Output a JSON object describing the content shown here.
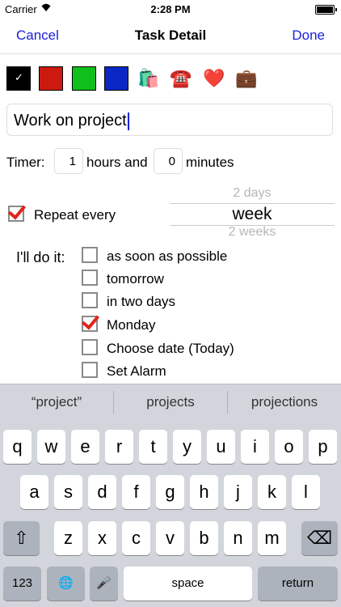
{
  "status": {
    "carrier": "Carrier",
    "time": "2:28 PM"
  },
  "nav": {
    "cancel": "Cancel",
    "title": "Task Detail",
    "done": "Done"
  },
  "colors": {
    "accent": "#1a22d8",
    "swatches": [
      "#000000",
      "#cc1a10",
      "#0fbf1b",
      "#0a27c6"
    ],
    "check": "#e0241b"
  },
  "icons": {
    "selected_swatch_check": "✓",
    "emojis": [
      "🛍️",
      "☎️",
      "❤️",
      "💼"
    ]
  },
  "task": {
    "value": "Work on project"
  },
  "timer": {
    "label": "Timer:",
    "hours": "1",
    "hours_text": "hours and",
    "minutes": "0",
    "minutes_text": "minutes"
  },
  "repeat": {
    "label": "Repeat every",
    "checked": true
  },
  "picker": {
    "above": "2 days",
    "selected": "week",
    "below": "2 weeks"
  },
  "schedule": {
    "label": "I'll do it:",
    "options": [
      {
        "text": "as soon as possible",
        "checked": false
      },
      {
        "text": "tomorrow",
        "checked": false
      },
      {
        "text": "in two days",
        "checked": false
      },
      {
        "text": "Monday",
        "checked": true
      },
      {
        "text": "Choose date (Today)",
        "checked": false
      },
      {
        "text": "Set Alarm",
        "checked": false
      }
    ]
  },
  "suggestions": [
    "“project”",
    "projects",
    "projections"
  ],
  "keyboard": {
    "row1": [
      "q",
      "w",
      "e",
      "r",
      "t",
      "y",
      "u",
      "i",
      "o",
      "p"
    ],
    "row2": [
      "a",
      "s",
      "d",
      "f",
      "g",
      "h",
      "j",
      "k",
      "l"
    ],
    "row3": [
      "z",
      "x",
      "c",
      "v",
      "b",
      "n",
      "m"
    ],
    "shift": "⇧",
    "delete": "⌫",
    "numbers": "123",
    "globe": "🌐",
    "mic": "🎤",
    "space": "space",
    "return": "return"
  }
}
